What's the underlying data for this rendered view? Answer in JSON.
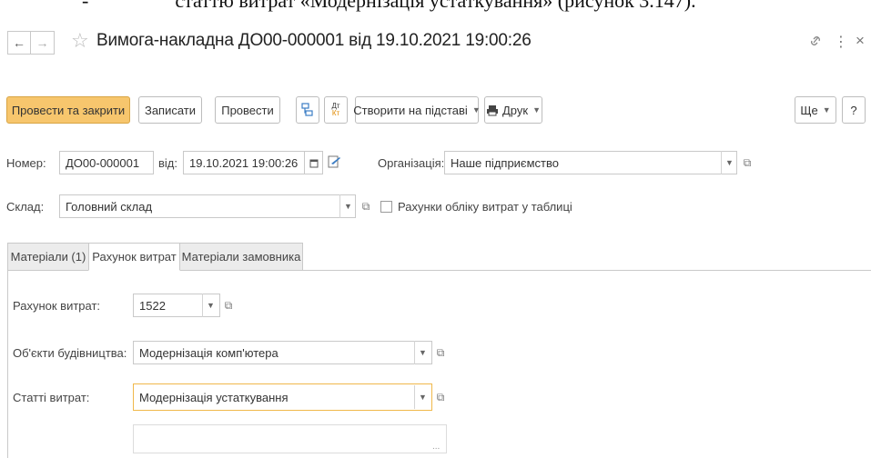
{
  "document_caption": {
    "bullet": "-",
    "text": "статтю витрат «Модернізація устаткування» (рисунок 3.147)."
  },
  "window": {
    "title": "Вимога-накладна ДО00-000001 від 19.10.2021 19:00:26",
    "back_icon": "←",
    "forward_icon": "→",
    "link_icon": "🔗",
    "menu_icon": "⋮",
    "close_icon": "×"
  },
  "toolbar": {
    "post_and_close": "Провести та закрити",
    "save": "Записати",
    "post": "Провести",
    "create_based_on": "Створити на підставі",
    "print": "Друк",
    "more": "Ще",
    "help": "?",
    "dt_kt_top": "Дт",
    "dt_kt_bottom": "Кт"
  },
  "header": {
    "number_label": "Номер:",
    "number_value": "ДО00-000001",
    "date_label": "від:",
    "date_value": "19.10.2021 19:00:26",
    "org_label": "Організація:",
    "org_value": "Наше підприємство",
    "warehouse_label": "Склад:",
    "warehouse_value": "Головний склад",
    "accounts_in_table_label": "Рахунки обліку витрат у таблиці",
    "accounts_in_table_checked": false
  },
  "tabs": [
    {
      "label": "Матеріали (1)",
      "active": false
    },
    {
      "label": "Рахунок витрат",
      "active": true
    },
    {
      "label": "Матеріали замовника",
      "active": false
    }
  ],
  "expense_tab": {
    "account_label": "Рахунок витрат:",
    "account_value": "1522",
    "objects_label": "Об'єкти будівництва:",
    "objects_value": "Модернізація комп'ютера",
    "items_label": "Статті витрат:",
    "items_value": "Модернізація устаткування",
    "extra_value": "",
    "extra_button": "..."
  },
  "colors": {
    "primary_button": "#f7c66d",
    "focus_border": "#f0b84a",
    "border": "#c9c9c9"
  }
}
